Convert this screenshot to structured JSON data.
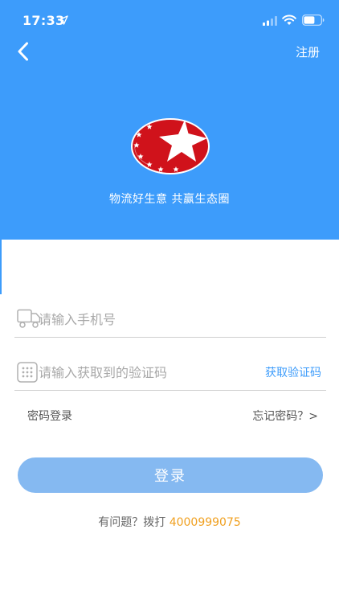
{
  "status_bar": {
    "time": "17:33"
  },
  "nav": {
    "register_label": "注册"
  },
  "brand": {
    "slogan": "物流好生意 共赢生态圈",
    "colors": {
      "header_blue": "#3d9cfb",
      "logo_red": "#d0121b",
      "button_blue": "#85b9f1",
      "phone_orange": "#f0a020"
    }
  },
  "form": {
    "phone_placeholder": "请输入手机号",
    "code_placeholder": "请输入获取到的验证码",
    "get_code_label": "获取验证码",
    "password_login_label": "密码登录",
    "forgot_password_label": "忘记密码？>",
    "login_button_label": "登录"
  },
  "help": {
    "prefix": "有问题？拨打 ",
    "phone": "4000999075"
  },
  "icons": {
    "back": "chevron-left-icon",
    "phone_field": "truck-icon",
    "code_field": "keypad-icon",
    "location": "location-arrow-icon",
    "signal": "signal-icon",
    "wifi": "wifi-icon",
    "battery": "battery-icon"
  }
}
